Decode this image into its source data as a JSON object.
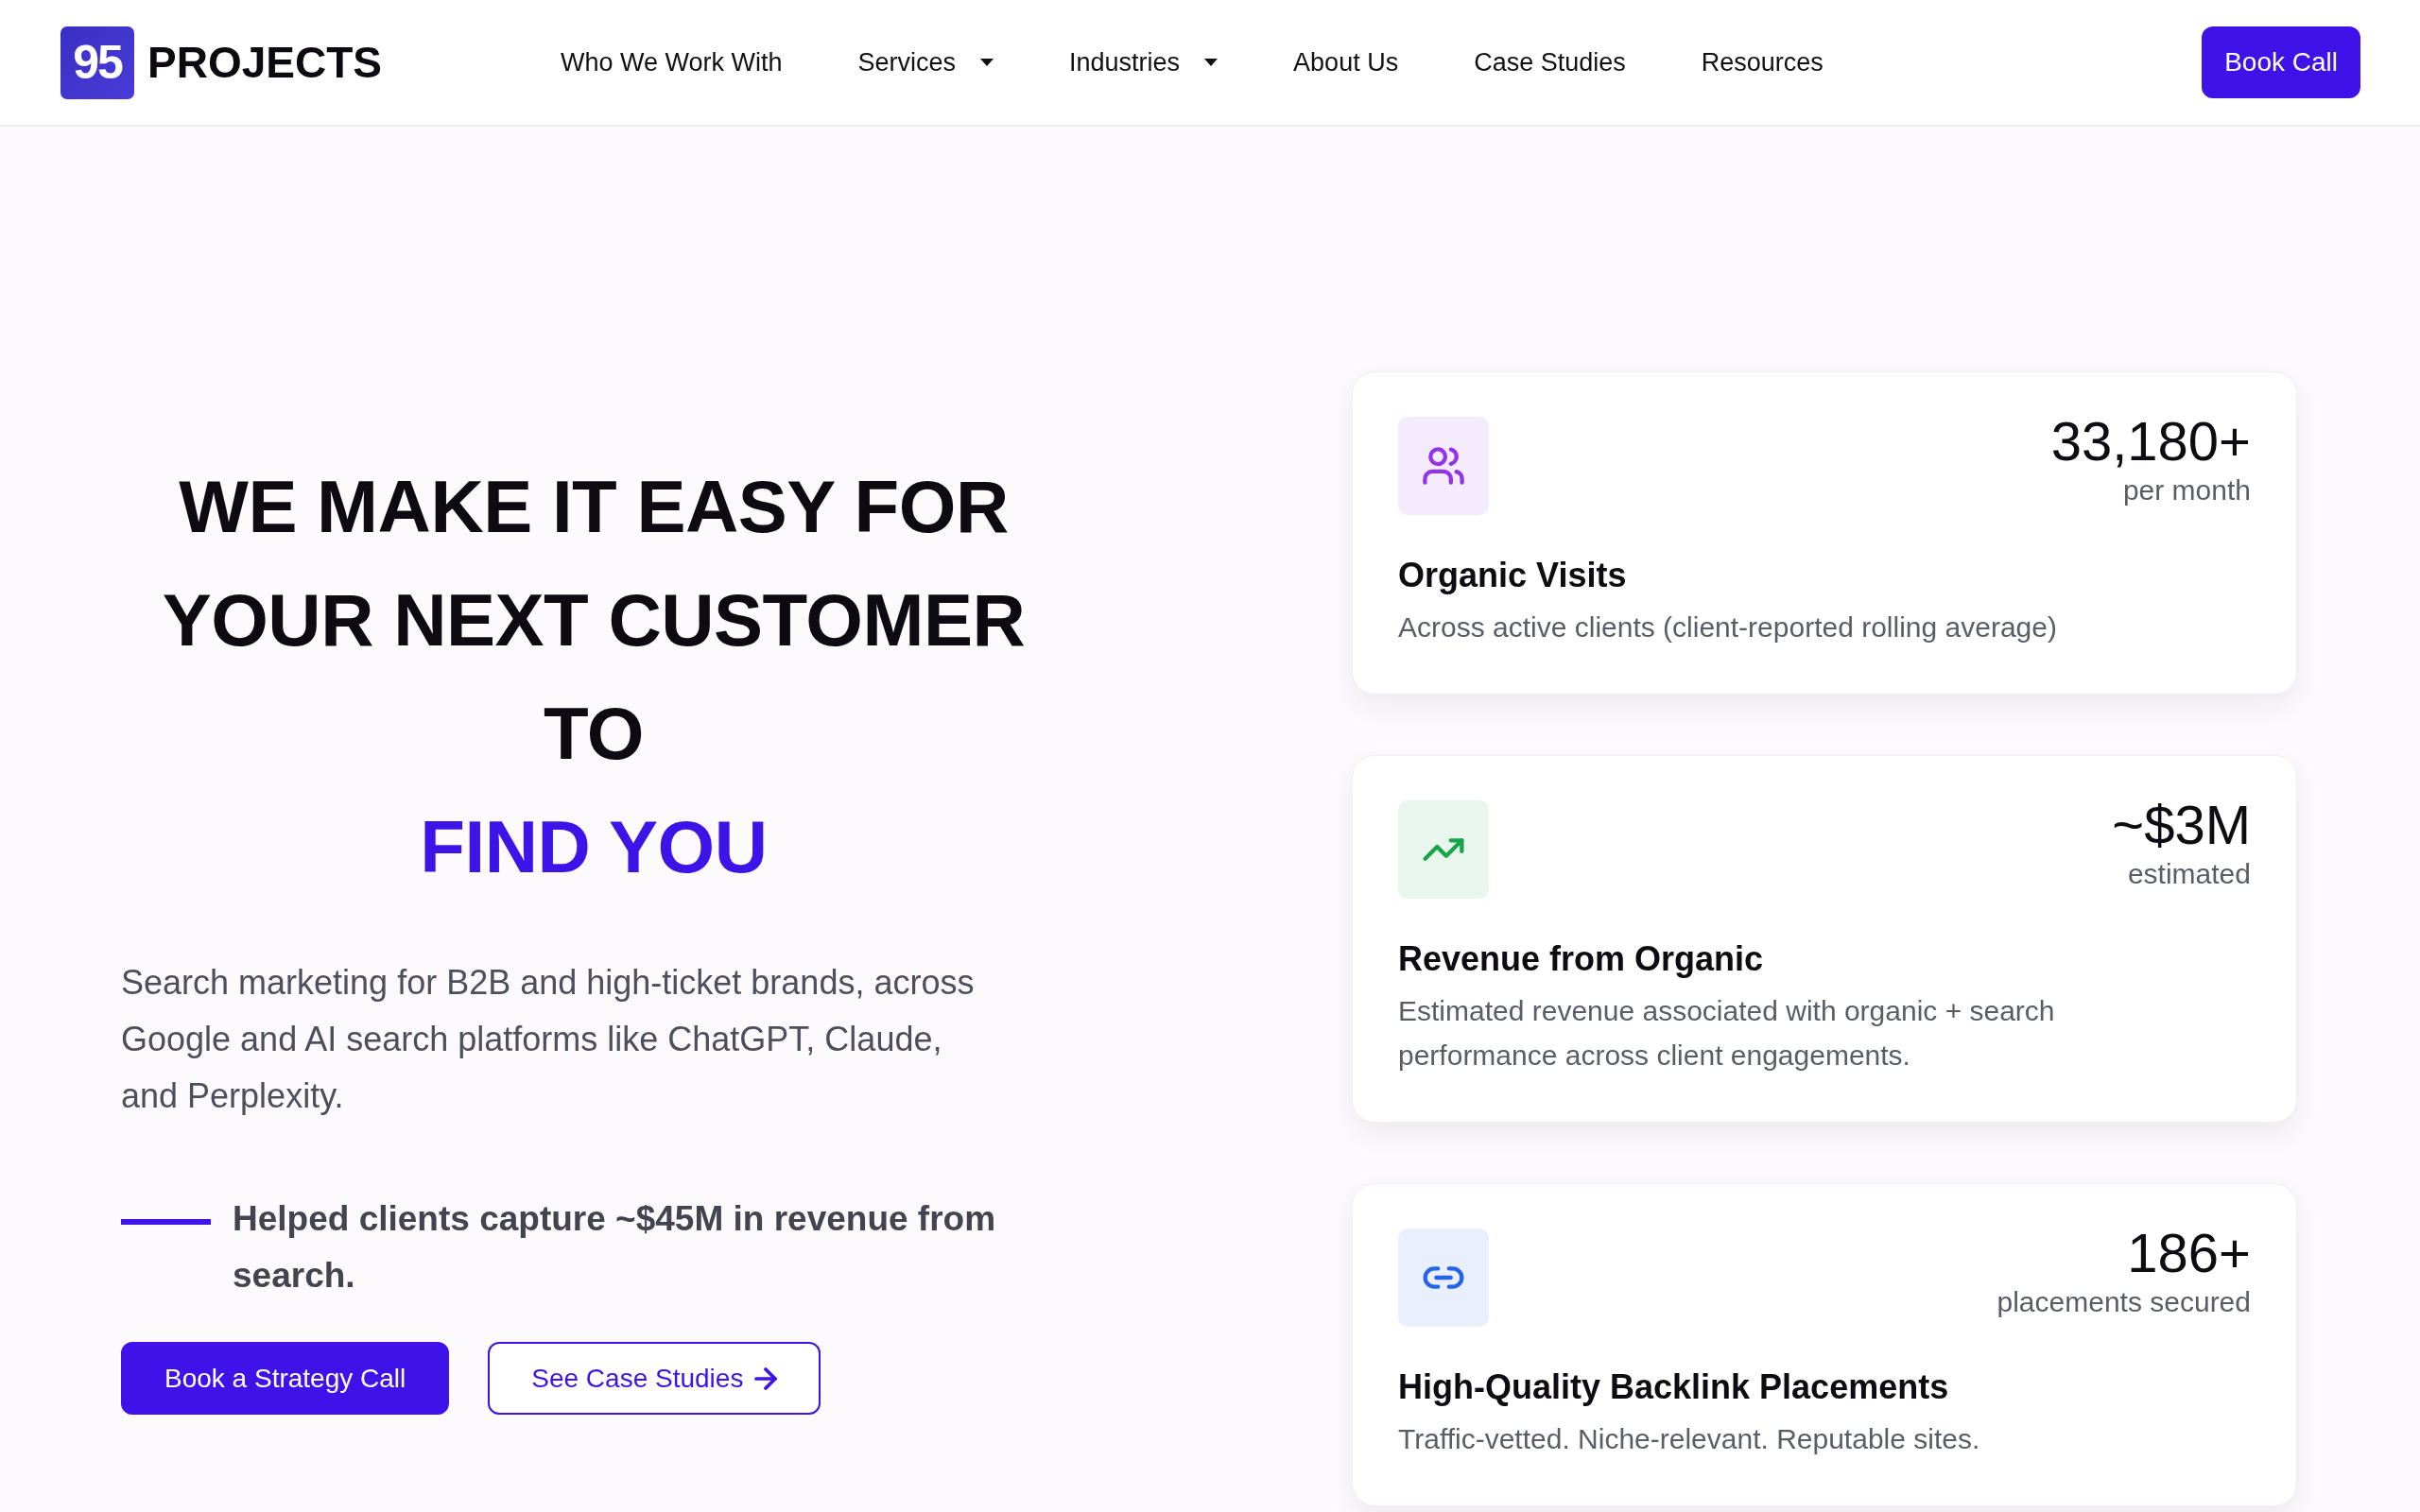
{
  "header": {
    "logo": {
      "badge": "95",
      "wordmark": "PROJECTS"
    },
    "nav": [
      {
        "label": "Who We Work With",
        "dropdown": false
      },
      {
        "label": "Services",
        "dropdown": true
      },
      {
        "label": "Industries",
        "dropdown": true
      },
      {
        "label": "About Us",
        "dropdown": false
      },
      {
        "label": "Case Studies",
        "dropdown": false
      },
      {
        "label": "Resources",
        "dropdown": false
      }
    ],
    "cta": "Book Call"
  },
  "hero": {
    "headline": {
      "lines": [
        "WE MAKE IT EASY FOR",
        "YOUR NEXT CUSTOMER",
        "TO"
      ],
      "highlight": "FIND YOU"
    },
    "description": "Search marketing for B2B and high-ticket brands, across Google and AI search platforms like ChatGPT, Claude, and Perplexity.",
    "proof": "Helped clients capture ~$45M in revenue from search.",
    "buttons": [
      {
        "label": "Book a Strategy Call",
        "kind": "primary"
      },
      {
        "label": "See Case Studies",
        "kind": "secondary"
      }
    ]
  },
  "stats": [
    {
      "value": "33,180+",
      "unit": "per month",
      "title": "Organic Visits",
      "description": "Across active clients (client-reported rolling average)",
      "color": "#9333ea"
    },
    {
      "value": "~$3M",
      "unit": "estimated",
      "title": "Revenue from Organic",
      "description": "Estimated revenue associated with organic + search performance across client engagements.",
      "color": "#16a34a"
    },
    {
      "value": "186+",
      "unit": "placements secured",
      "title": "High-Quality Backlink Placements",
      "description": "Traffic-vetted. Niche-relevant. Reputable sites.",
      "color": "#2563eb"
    }
  ]
}
